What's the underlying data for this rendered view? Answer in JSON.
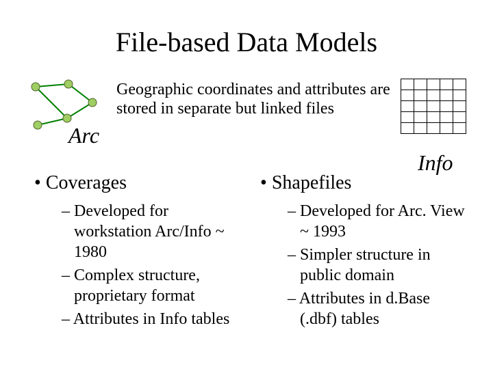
{
  "title": "File-based Data Models",
  "subtitle": "Geographic coordinates and attributes are stored in separate but linked files",
  "arc_label": "Arc",
  "info_label": "Info",
  "left": {
    "heading": "Coverages",
    "items": [
      "Developed for workstation Arc/Info ~ 1980",
      "Complex structure, proprietary format",
      "Attributes in Info tables"
    ]
  },
  "right": {
    "heading": "Shapefiles",
    "items": [
      "Developed for Arc. View ~ 1993",
      "Simpler structure in public domain",
      "Attributes in d.Base (.dbf) tables"
    ]
  },
  "colors": {
    "node_fill": "#9FCE63",
    "node_stroke": "#4F6228",
    "edge": "#008000"
  }
}
